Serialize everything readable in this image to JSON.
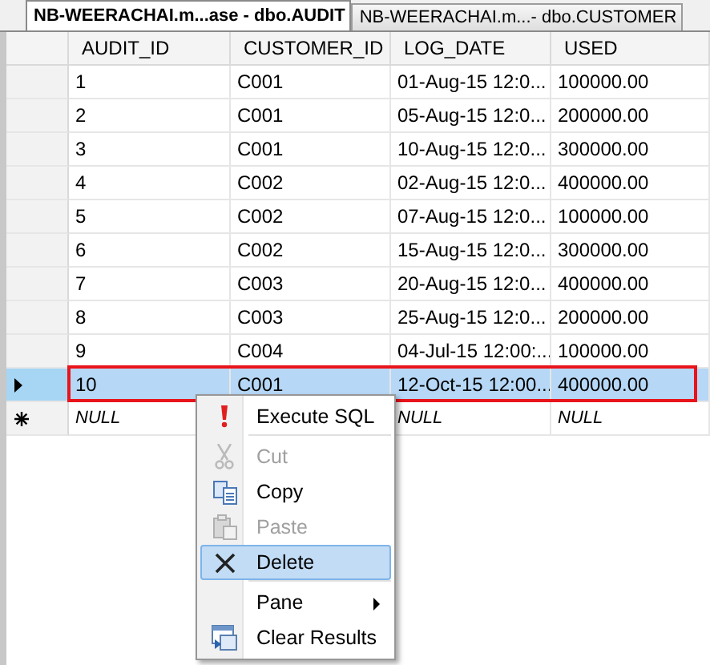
{
  "tabs": [
    {
      "label": "NB-WEERACHAI.m...ase - dbo.AUDIT",
      "selected": true
    },
    {
      "label": "NB-WEERACHAI.m...- dbo.CUSTOMER",
      "selected": false
    }
  ],
  "grid": {
    "columns": [
      "AUDIT_ID",
      "CUSTOMER_ID",
      "LOG_DATE",
      "USED"
    ],
    "rows": [
      {
        "cells": [
          "1",
          "C001",
          "01-Aug-15 12:0...",
          "100000.00"
        ],
        "selected": false,
        "outlined": false
      },
      {
        "cells": [
          "2",
          "C001",
          "05-Aug-15 12:0...",
          "200000.00"
        ],
        "selected": false,
        "outlined": false
      },
      {
        "cells": [
          "3",
          "C001",
          "10-Aug-15 12:0...",
          "300000.00"
        ],
        "selected": false,
        "outlined": false
      },
      {
        "cells": [
          "4",
          "C002",
          "02-Aug-15 12:0...",
          "400000.00"
        ],
        "selected": false,
        "outlined": false
      },
      {
        "cells": [
          "5",
          "C002",
          "07-Aug-15 12:0...",
          "100000.00"
        ],
        "selected": false,
        "outlined": false
      },
      {
        "cells": [
          "6",
          "C002",
          "15-Aug-15 12:0...",
          "300000.00"
        ],
        "selected": false,
        "outlined": false
      },
      {
        "cells": [
          "7",
          "C003",
          "20-Aug-15 12:0...",
          "400000.00"
        ],
        "selected": false,
        "outlined": false
      },
      {
        "cells": [
          "8",
          "C003",
          "25-Aug-15 12:0...",
          "200000.00"
        ],
        "selected": false,
        "outlined": false
      },
      {
        "cells": [
          "9",
          "C004",
          "04-Jul-15 12:00:...",
          "100000.00"
        ],
        "selected": false,
        "outlined": false
      },
      {
        "cells": [
          "10",
          "C001",
          "12-Oct-15 12:00...",
          "400000.00"
        ],
        "selected": true,
        "outlined": true
      }
    ],
    "new_row": {
      "column_1": "NULL",
      "column_3": "NULL",
      "column_4": "NULL"
    }
  },
  "context_menu": {
    "items": [
      {
        "kind": "command",
        "label": "Execute SQL",
        "disabled": false,
        "selected": false
      },
      {
        "kind": "separator"
      },
      {
        "kind": "command",
        "label": "Cut",
        "disabled": true,
        "selected": false
      },
      {
        "kind": "command",
        "label": "Copy",
        "disabled": false,
        "selected": false
      },
      {
        "kind": "command",
        "label": "Paste",
        "disabled": true,
        "selected": false
      },
      {
        "kind": "command",
        "label": "Delete",
        "disabled": false,
        "selected": true
      },
      {
        "kind": "separator"
      },
      {
        "kind": "submenu",
        "label": "Pane",
        "disabled": false,
        "selected": false
      },
      {
        "kind": "command",
        "label": "Clear Results",
        "disabled": false,
        "selected": false
      }
    ]
  }
}
